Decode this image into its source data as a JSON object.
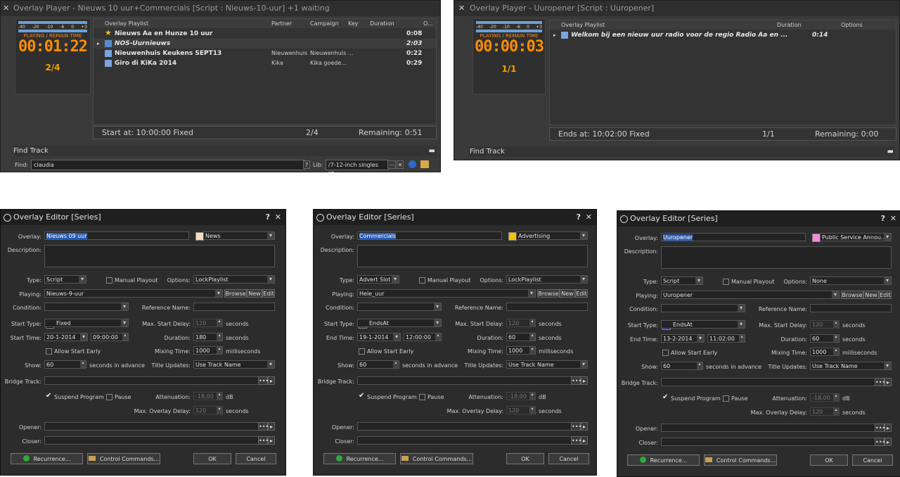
{
  "players": [
    {
      "close": "✕",
      "title": "Overlay Player - Nieuws 10 uur+Commercials [Script : Nieuws-10-uur] +1 waiting",
      "vu_scale": [
        "-40",
        "-20",
        "-10",
        "-6",
        "0",
        "+3"
      ],
      "playing_label": "PLAYING / REMAIN TIME",
      "clock": "00:01:22",
      "counter": "2/4",
      "columns": [
        "Overlay Playlist",
        "Partner",
        "Campaign",
        "Key",
        "Duration",
        "O..."
      ],
      "rows": [
        {
          "icon": "star-icon",
          "title": "Nieuws Aa en Hunze 10 uur",
          "partner": "",
          "campaign": "",
          "duration": "0:08"
        },
        {
          "icon": "play-arrow-icon",
          "title": "NOS-Uurnieuws",
          "partner": "",
          "campaign": "",
          "duration": "2:03"
        },
        {
          "icon": "music-note-icon",
          "title": "Nieuwenhuis Keukens SEPT13",
          "partner": "Nieuwenhuis",
          "campaign": "Nieuwenhuis ...",
          "duration": "0:22"
        },
        {
          "icon": "music-note-icon",
          "title": "Giro di KiKa 2014",
          "partner": "Kika",
          "campaign": "Kika goede...",
          "duration": "0:29"
        }
      ],
      "status_left": "Start at: 10:00:00   Fixed",
      "status_mid": "2/4",
      "status_right": "Remaining: 0:51",
      "find_track": "Find Track",
      "find_label": "Find:",
      "find_value": "claudia",
      "lib_label": "Lib:",
      "lib_value": "/7-12-inch singles [7..."
    },
    {
      "close": "✕",
      "title": "Overlay Player - Uuropener [Script : Uuropener]",
      "vu_scale": [
        "-40",
        "-20",
        "-10",
        "-6",
        "0",
        "+3"
      ],
      "playing_label": "PLAYING / REMAIN TIME",
      "clock": "00:00:03",
      "counter": "1/1",
      "columns": [
        "Overlay Playlist",
        "Duration",
        "Options"
      ],
      "rows": [
        {
          "icon": "music-note-icon",
          "title": "Welkom bij een nieuw uur radio voor de regio Radio Aa en ...",
          "duration": "0:14"
        }
      ],
      "status_left": "Ends at: 10:02:00   Fixed",
      "status_mid": "1/1",
      "status_right": "Remaining: 0:00",
      "find_track": "Find Track"
    }
  ],
  "editors": [
    {
      "title": "Overlay Editor [Series]",
      "help": "?",
      "close": "✕",
      "overlay": "Nieuws 09 uur",
      "category": "News",
      "category_color": "#f5dcc0",
      "type": "Script",
      "manual_playout": "Manual Playout",
      "options": "LockPlaylist",
      "playing": "Nieuws-9-uur",
      "start_type": "Fixed",
      "start_type_color": "#000000",
      "time_label": "Start Time:",
      "date": "20-1-2014",
      "time": "09:00:00",
      "max_start_delay": "120",
      "duration": "180",
      "mixing_time": "1000",
      "show": "60",
      "title_updates": "Use Track Name",
      "attenuation": "-18,00",
      "max_overlay_delay": "120"
    },
    {
      "title": "Overlay Editor [Series]",
      "help": "?",
      "close": "✕",
      "overlay": "Commercials",
      "category": "Advertising",
      "category_color": "#f5c400",
      "type": "Advert Slot",
      "manual_playout": "Manual Playout",
      "options": "LockPlaylist",
      "playing": "Hele_uur",
      "start_type": "EndsAt",
      "start_type_color": "#1020e0",
      "time_label": "End Time:",
      "date": "19-1-2014",
      "time": "12:00:00",
      "max_start_delay": "120",
      "duration": "60",
      "mixing_time": "1000",
      "show": "60",
      "title_updates": "Use Track Name",
      "attenuation": "-18,00",
      "max_overlay_delay": "120"
    },
    {
      "title": "Overlay Editor [Series]",
      "help": "?",
      "close": "✕",
      "overlay": "Uuropener",
      "category": "Public Service Annou...",
      "category_color": "#f58ad8",
      "type": "Script",
      "manual_playout": "Manual Playout",
      "options": "None",
      "playing": "Uuropener",
      "start_type": "EndsAt",
      "start_type_color": "#1020e0",
      "time_label": "End Time:",
      "date": "13-2-2014",
      "time": "11:02:00",
      "max_start_delay": "120",
      "duration": "60",
      "mixing_time": "1000",
      "show": "60",
      "title_updates": "Use Track Name",
      "attenuation": "-18,00",
      "max_overlay_delay": "120"
    }
  ],
  "labels": {
    "overlay": "Overlay:",
    "description": "Description:",
    "type": "Type:",
    "options": "Options:",
    "playing": "Playing:",
    "browse": "Browse",
    "new": "New",
    "edit": "Edit",
    "condition": "Condition:",
    "reference_name": "Reference Name:",
    "start_type": "Start Type:",
    "max_start_delay": "Max. Start Delay:",
    "seconds": "seconds",
    "duration": "Duration:",
    "allow_start_early": "Allow Start Early",
    "mixing_time": "Mixing Time:",
    "milliseconds": "milliseconds",
    "show": "Show:",
    "seconds_in_advance": "seconds in advance",
    "title_updates": "Title Updates:",
    "bridge_track": "Bridge Track:",
    "suspend_program": "Suspend Program",
    "pause": "Pause",
    "attenuation": "Attenuation:",
    "db": "dB",
    "max_overlay_delay": "Max. Overlay Delay:",
    "opener": "Opener:",
    "closer": "Closer:",
    "recurrence": "Recurrence...",
    "control_commands": "Control Commands...",
    "ok": "OK",
    "cancel": "Cancel",
    "ellipsis": "•••",
    "arrow": "▸"
  }
}
